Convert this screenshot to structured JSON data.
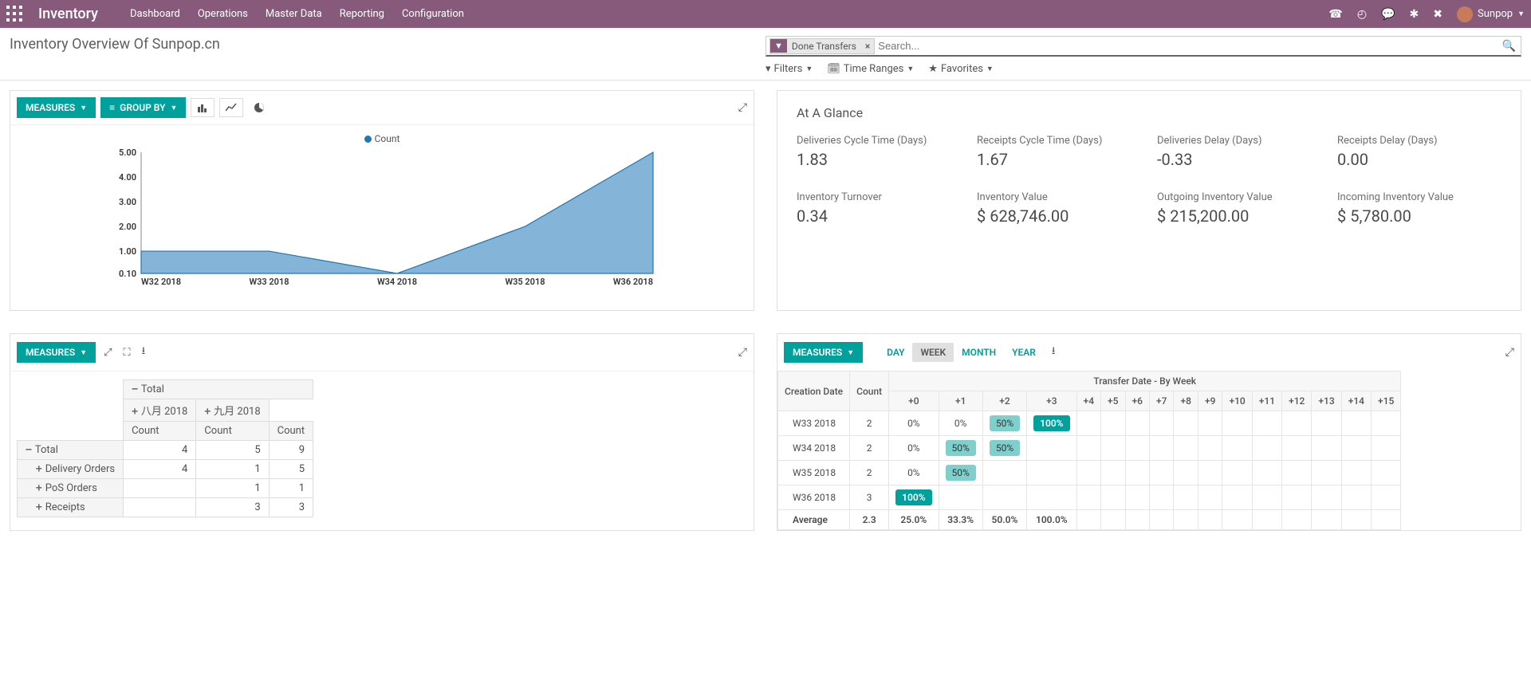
{
  "navbar": {
    "brand": "Inventory",
    "menu": [
      "Dashboard",
      "Operations",
      "Master Data",
      "Reporting",
      "Configuration"
    ],
    "user": "Sunpop"
  },
  "page": {
    "title": "Inventory Overview Of Sunpop.cn",
    "search_tag": "Done Transfers",
    "search_placeholder": "Search...",
    "filters_label": "Filters",
    "time_ranges_label": "Time Ranges",
    "favorites_label": "Favorites"
  },
  "controls": {
    "measures": "MEASURES",
    "group_by": "GROUP BY"
  },
  "chart_data": {
    "type": "area",
    "title": "",
    "legend": "Count",
    "ylabel": "",
    "xlabel": "",
    "ylim": [
      0.1,
      5.0
    ],
    "yticks": [
      0.1,
      1.0,
      2.0,
      3.0,
      4.0,
      5.0
    ],
    "categories": [
      "W32 2018",
      "W33 2018",
      "W34 2018",
      "W35 2018",
      "W36 2018"
    ],
    "values": [
      1.0,
      1.0,
      0.1,
      2.0,
      5.0
    ]
  },
  "glance": {
    "heading": "At A Glance",
    "kpis": [
      {
        "label": "Deliveries Cycle Time (Days)",
        "value": "1.83"
      },
      {
        "label": "Receipts Cycle Time (Days)",
        "value": "1.67"
      },
      {
        "label": "Deliveries Delay (Days)",
        "value": "-0.33"
      },
      {
        "label": "Receipts Delay (Days)",
        "value": "0.00"
      },
      {
        "label": "Inventory Turnover",
        "value": "0.34"
      },
      {
        "label": "Inventory Value",
        "value": "$ 628,746.00"
      },
      {
        "label": "Outgoing Inventory Value",
        "value": "$ 215,200.00"
      },
      {
        "label": "Incoming Inventory Value",
        "value": "$ 5,780.00"
      }
    ]
  },
  "pivot": {
    "total_label": "Total",
    "col_groups": [
      "八月 2018",
      "九月 2018"
    ],
    "count_label": "Count",
    "rows": [
      {
        "label": "Total",
        "expand": "minus",
        "cells": [
          "4",
          "5",
          "9"
        ]
      },
      {
        "label": "Delivery Orders",
        "expand": "plus",
        "cells": [
          "4",
          "1",
          "5"
        ]
      },
      {
        "label": "PoS Orders",
        "expand": "plus",
        "cells": [
          "",
          "1",
          "1"
        ]
      },
      {
        "label": "Receipts",
        "expand": "plus",
        "cells": [
          "",
          "3",
          "3"
        ]
      }
    ]
  },
  "cohort": {
    "time_buttons": [
      "DAY",
      "WEEK",
      "MONTH",
      "YEAR"
    ],
    "active_time": "WEEK",
    "header_creation": "Creation Date",
    "header_count": "Count",
    "header_spread": "Transfer Date - By Week",
    "offsets": [
      "+0",
      "+1",
      "+2",
      "+3",
      "+4",
      "+5",
      "+6",
      "+7",
      "+8",
      "+9",
      "+10",
      "+11",
      "+12",
      "+13",
      "+14",
      "+15"
    ],
    "rows": [
      {
        "label": "W33 2018",
        "count": "2",
        "cells": [
          "0%",
          "0%",
          "50%",
          "100%",
          "",
          "",
          "",
          "",
          "",
          "",
          "",
          "",
          "",
          "",
          "",
          ""
        ]
      },
      {
        "label": "W34 2018",
        "count": "2",
        "cells": [
          "0%",
          "50%",
          "50%",
          "",
          "",
          "",
          "",
          "",
          "",
          "",
          "",
          "",
          "",
          "",
          "",
          ""
        ]
      },
      {
        "label": "W35 2018",
        "count": "2",
        "cells": [
          "0%",
          "50%",
          "",
          "",
          "",
          "",
          "",
          "",
          "",
          "",
          "",
          "",
          "",
          "",
          "",
          ""
        ]
      },
      {
        "label": "W36 2018",
        "count": "3",
        "cells": [
          "100%",
          "",
          "",
          "",
          "",
          "",
          "",
          "",
          "",
          "",
          "",
          "",
          "",
          "",
          "",
          ""
        ]
      }
    ],
    "average": {
      "label": "Average",
      "count": "2.3",
      "cells": [
        "25.0%",
        "33.3%",
        "50.0%",
        "100.0%",
        "",
        "",
        "",
        "",
        "",
        "",
        "",
        "",
        "",
        "",
        "",
        ""
      ]
    }
  }
}
